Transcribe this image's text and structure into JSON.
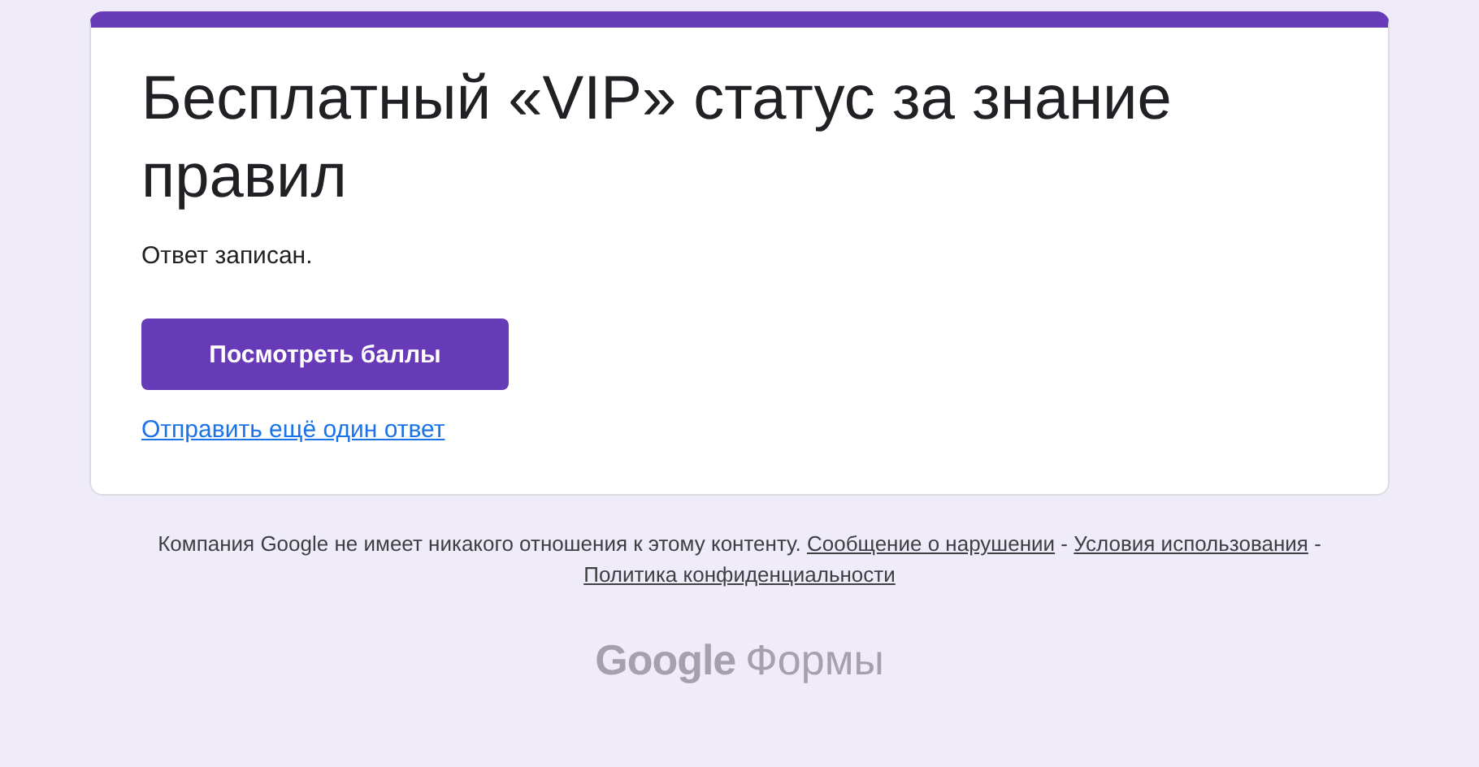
{
  "form": {
    "title": "Бесплатный «VIP» статус за знание правил",
    "message": "Ответ записан.",
    "primary_button": "Посмотреть баллы",
    "link": "Отправить ещё один ответ"
  },
  "footer": {
    "text": "Компания Google не имеет никакого отношения к этому контенту.",
    "links": [
      "Сообщение о нарушении",
      "Условия использования",
      "Политика конфиденциальности"
    ],
    "separator": "-"
  },
  "logo": {
    "brand": "Google",
    "product": "Формы"
  }
}
